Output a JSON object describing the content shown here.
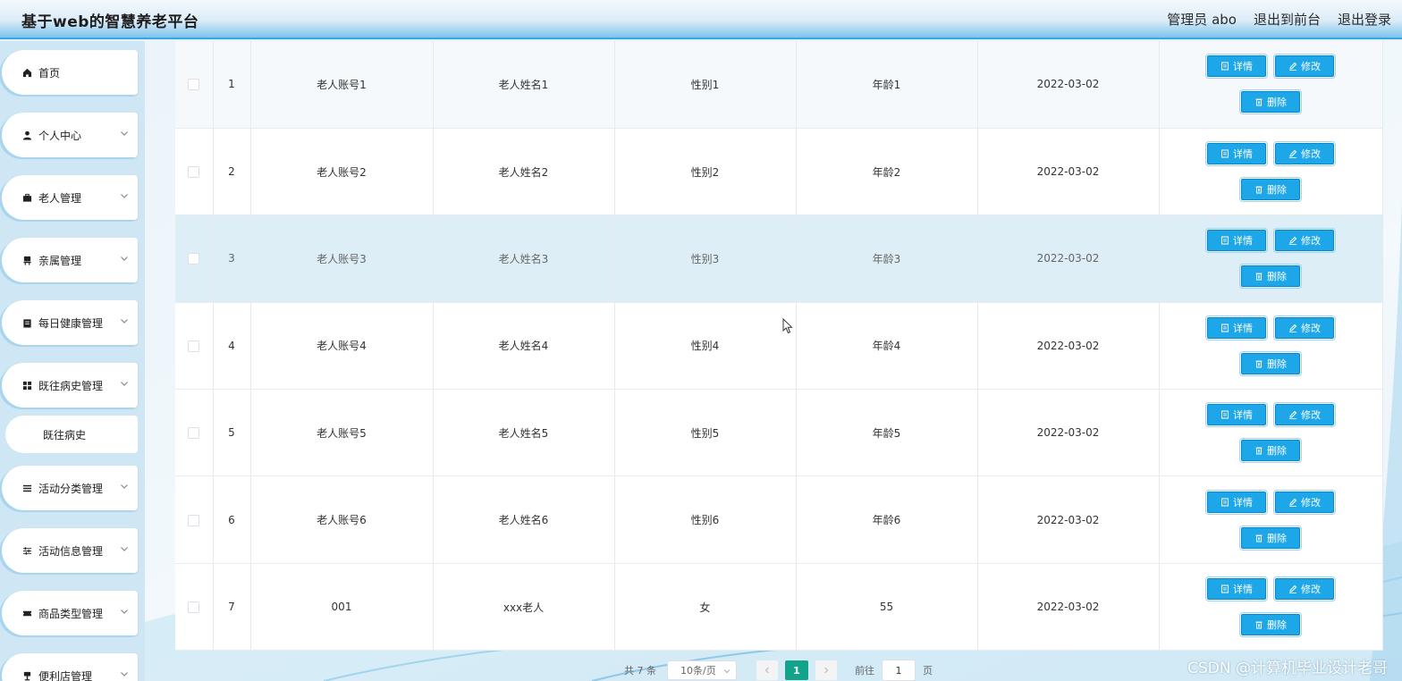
{
  "header": {
    "brand": "基于web的智慧养老平台",
    "nav": [
      "管理员 abo",
      "退出到前台",
      "退出登录"
    ]
  },
  "sidebar": {
    "items": [
      {
        "label": "首页",
        "icon": "home-icon",
        "has_arrow": false
      },
      {
        "label": "个人中心",
        "icon": "user-icon",
        "has_arrow": true
      },
      {
        "label": "老人管理",
        "icon": "briefcase-icon",
        "has_arrow": true
      },
      {
        "label": "亲属管理",
        "icon": "chair-icon",
        "has_arrow": true
      },
      {
        "label": "每日健康管理",
        "icon": "clipboard-icon",
        "has_arrow": true
      },
      {
        "label": "既往病史管理",
        "icon": "grid-icon",
        "has_arrow": true
      },
      {
        "label": "活动分类管理",
        "icon": "list-icon",
        "has_arrow": true
      },
      {
        "label": "活动信息管理",
        "icon": "sliders-icon",
        "has_arrow": true
      },
      {
        "label": "商品类型管理",
        "icon": "ticket-icon",
        "has_arrow": true
      },
      {
        "label": "便利店管理",
        "icon": "store-icon",
        "has_arrow": true
      }
    ],
    "submenu": {
      "label": "既往病史"
    }
  },
  "table": {
    "rows": [
      {
        "index": "1",
        "account": "老人账号1",
        "name": "老人姓名1",
        "gender": "性别1",
        "age": "年龄1",
        "date": "2022-03-02"
      },
      {
        "index": "2",
        "account": "老人账号2",
        "name": "老人姓名2",
        "gender": "性别2",
        "age": "年龄2",
        "date": "2022-03-02"
      },
      {
        "index": "3",
        "account": "老人账号3",
        "name": "老人姓名3",
        "gender": "性别3",
        "age": "年龄3",
        "date": "2022-03-02"
      },
      {
        "index": "4",
        "account": "老人账号4",
        "name": "老人姓名4",
        "gender": "性别4",
        "age": "年龄4",
        "date": "2022-03-02"
      },
      {
        "index": "5",
        "account": "老人账号5",
        "name": "老人姓名5",
        "gender": "性别5",
        "age": "年龄5",
        "date": "2022-03-02"
      },
      {
        "index": "6",
        "account": "老人账号6",
        "name": "老人姓名6",
        "gender": "性别6",
        "age": "年龄6",
        "date": "2022-03-02"
      },
      {
        "index": "7",
        "account": "001",
        "name": "xxx老人",
        "gender": "女",
        "age": "55",
        "date": "2022-03-02"
      }
    ],
    "buttons": {
      "detail": "详情",
      "edit": "修改",
      "delete": "删除"
    }
  },
  "pagination": {
    "total": "共 7 条",
    "page_size": "10条/页",
    "current_page": "1",
    "goto_label": "前往",
    "goto_value": "1",
    "page_suffix": "页"
  },
  "watermark": "CSDN @计算机毕业设计老哥",
  "colors": {
    "accent": "#1ea7e8",
    "active_page": "#13a38c",
    "header_border": "#39a6e2"
  }
}
